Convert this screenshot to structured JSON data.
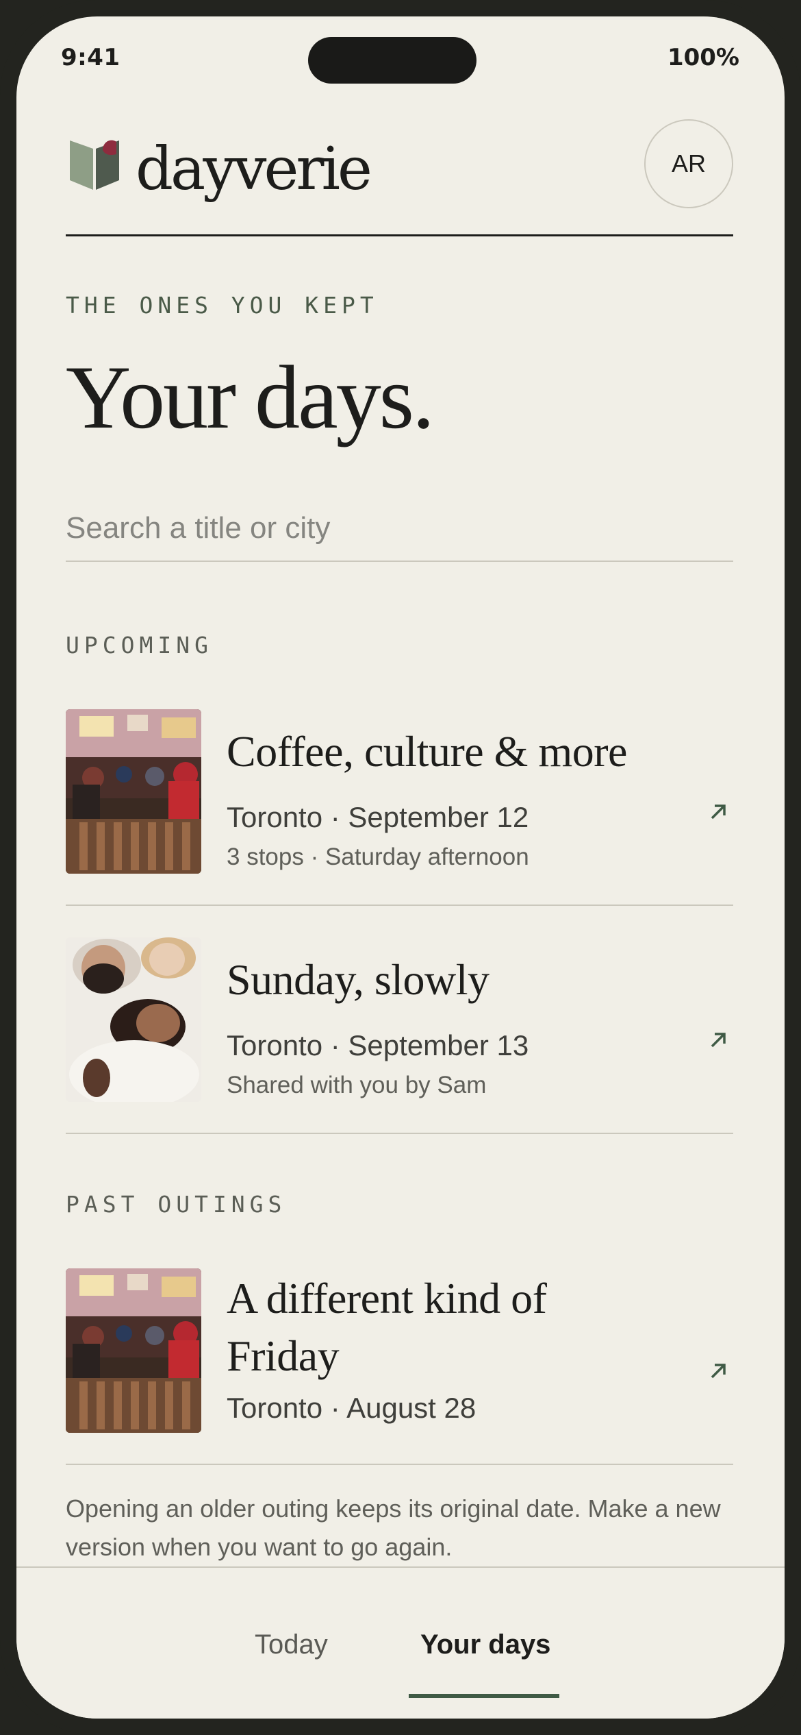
{
  "status_bar": {
    "time": "9:41",
    "battery": "100%"
  },
  "header": {
    "brand": "dayverie",
    "avatar_initials": "AR"
  },
  "hero": {
    "eyebrow": "THE ONES YOU KEPT",
    "title": "Your days."
  },
  "search": {
    "placeholder": "Search a title or city",
    "value": ""
  },
  "sections": {
    "upcoming": {
      "label": "UPCOMING",
      "items": [
        {
          "title": "Coffee, culture & more",
          "meta": "Toronto · September 12",
          "sub": "3 stops · Saturday afternoon",
          "image": "cafe-photo"
        },
        {
          "title": "Sunday, slowly",
          "meta": "Toronto · September 13",
          "sub": "Shared with you by Sam",
          "image": "friends-photo"
        }
      ]
    },
    "past": {
      "label": "PAST OUTINGS",
      "items": [
        {
          "title": "A different kind of Friday",
          "meta": "Toronto · August 28",
          "image": "cafe-photo"
        }
      ]
    }
  },
  "footnote": "Opening an older outing keeps its original date. Make a new version when you want to go again.",
  "tabs": {
    "today": "Today",
    "your_days": "Your days",
    "active": "your_days"
  },
  "colors": {
    "background": "#f1efe7",
    "frame": "#23241f",
    "ink": "#1d1d1b",
    "accent_green": "#3f5a45",
    "divider": "#cbc8bd"
  }
}
